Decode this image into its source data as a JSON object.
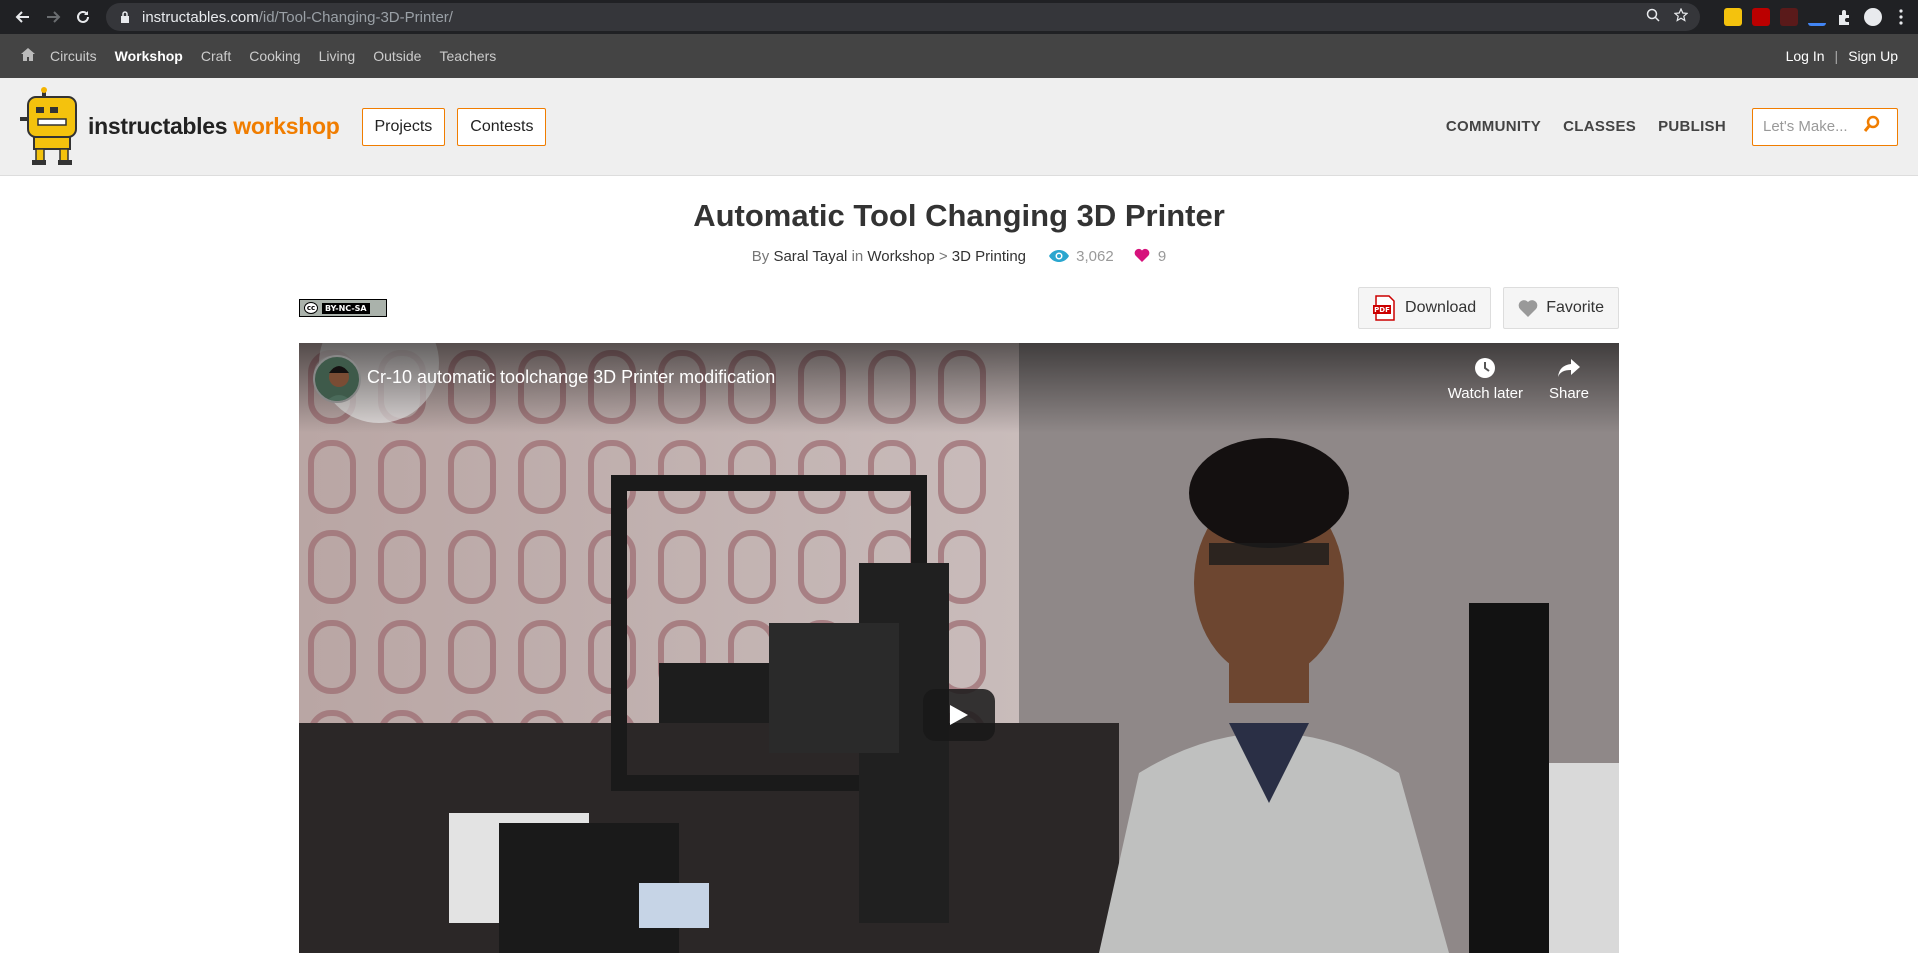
{
  "browser": {
    "url_host": "instructables.com",
    "url_path": "/id/Tool-Changing-3D-Printer/"
  },
  "topnav": {
    "items": [
      "Circuits",
      "Workshop",
      "Craft",
      "Cooking",
      "Living",
      "Outside",
      "Teachers"
    ],
    "active": "Workshop",
    "login": "Log In",
    "separator": "|",
    "signup": "Sign Up"
  },
  "header": {
    "logo_main": "instructables",
    "logo_accent": "workshop",
    "projects": "Projects",
    "contests": "Contests",
    "community": "COMMUNITY",
    "classes": "CLASSES",
    "publish": "PUBLISH",
    "search_placeholder": "Let's Make..."
  },
  "article": {
    "title": "Automatic Tool Changing 3D Printer",
    "by": "By",
    "author": "Saral Tayal",
    "in": "in",
    "category": "Workshop",
    "arrow": ">",
    "subcategory": "3D Printing",
    "views": "3,062",
    "likes": "9",
    "license": "BY-NC-SA",
    "license_cc": "cc",
    "download": "Download",
    "favorite": "Favorite"
  },
  "video": {
    "title": "Cr-10 automatic toolchange 3D Printer modification",
    "watch_later": "Watch later",
    "share": "Share"
  },
  "colors": {
    "accent": "#f07d00",
    "topnav_bg": "#444444",
    "header_bg": "#efefef",
    "views_icon": "#2aa6cf",
    "heart": "#d6127c"
  }
}
